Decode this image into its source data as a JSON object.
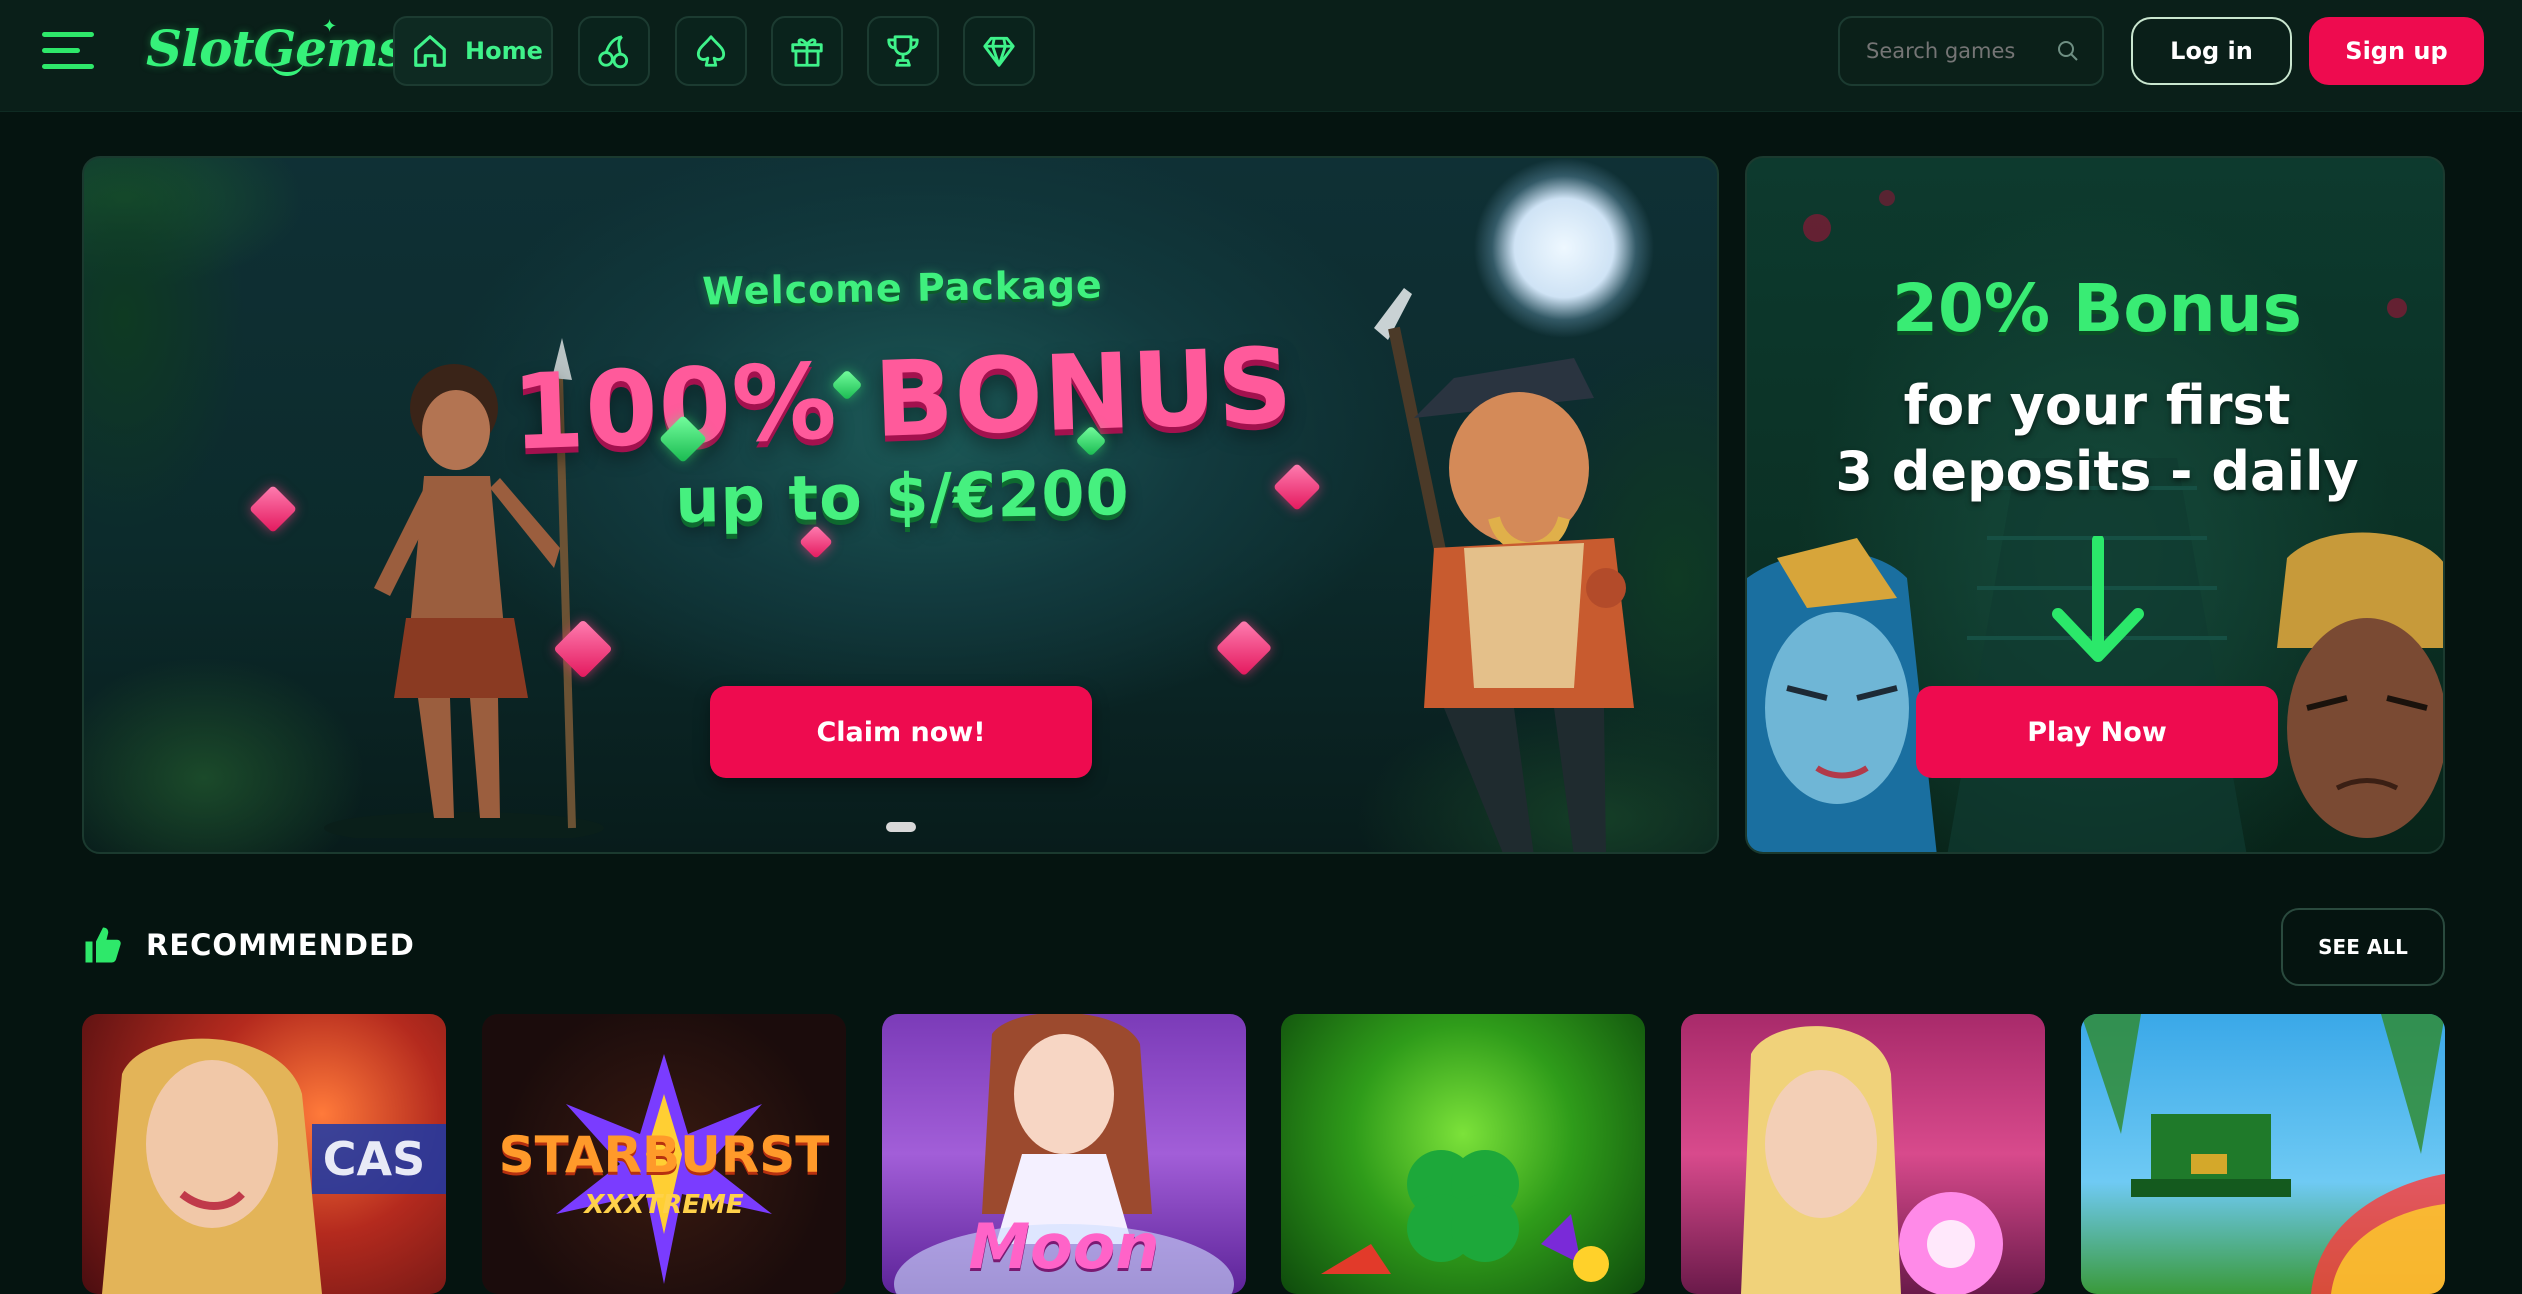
{
  "header": {
    "logo": "SlotGems",
    "home_label": "Home",
    "nav_icons": [
      "cherries-icon",
      "spade-icon",
      "gift-icon",
      "trophy-icon",
      "diamond-icon"
    ],
    "search_placeholder": "Search games",
    "login_label": "Log in",
    "signup_label": "Sign up"
  },
  "banner_main": {
    "welcome": "Welcome Package",
    "headline": "100% BONUS",
    "subline": "up to $/€200",
    "cta": "Claim now!"
  },
  "banner_side": {
    "title": "20% Bonus",
    "line1": "for your first",
    "line2": "3 deposits - daily",
    "cta": "Play Now"
  },
  "recommended": {
    "title": "RECOMMENDED",
    "see_all": "SEE ALL",
    "games": [
      {
        "text": "CAS"
      },
      {
        "text": "STARBURST",
        "subtext": "XXXTREME"
      },
      {
        "text": "Moon"
      },
      {
        "text": ""
      },
      {
        "text": ""
      },
      {
        "text": ""
      }
    ]
  },
  "colors": {
    "accent_green": "#2ee86a",
    "cta_red": "#ee0b4f",
    "background": "#051410",
    "header_bg": "#0a1f19"
  }
}
